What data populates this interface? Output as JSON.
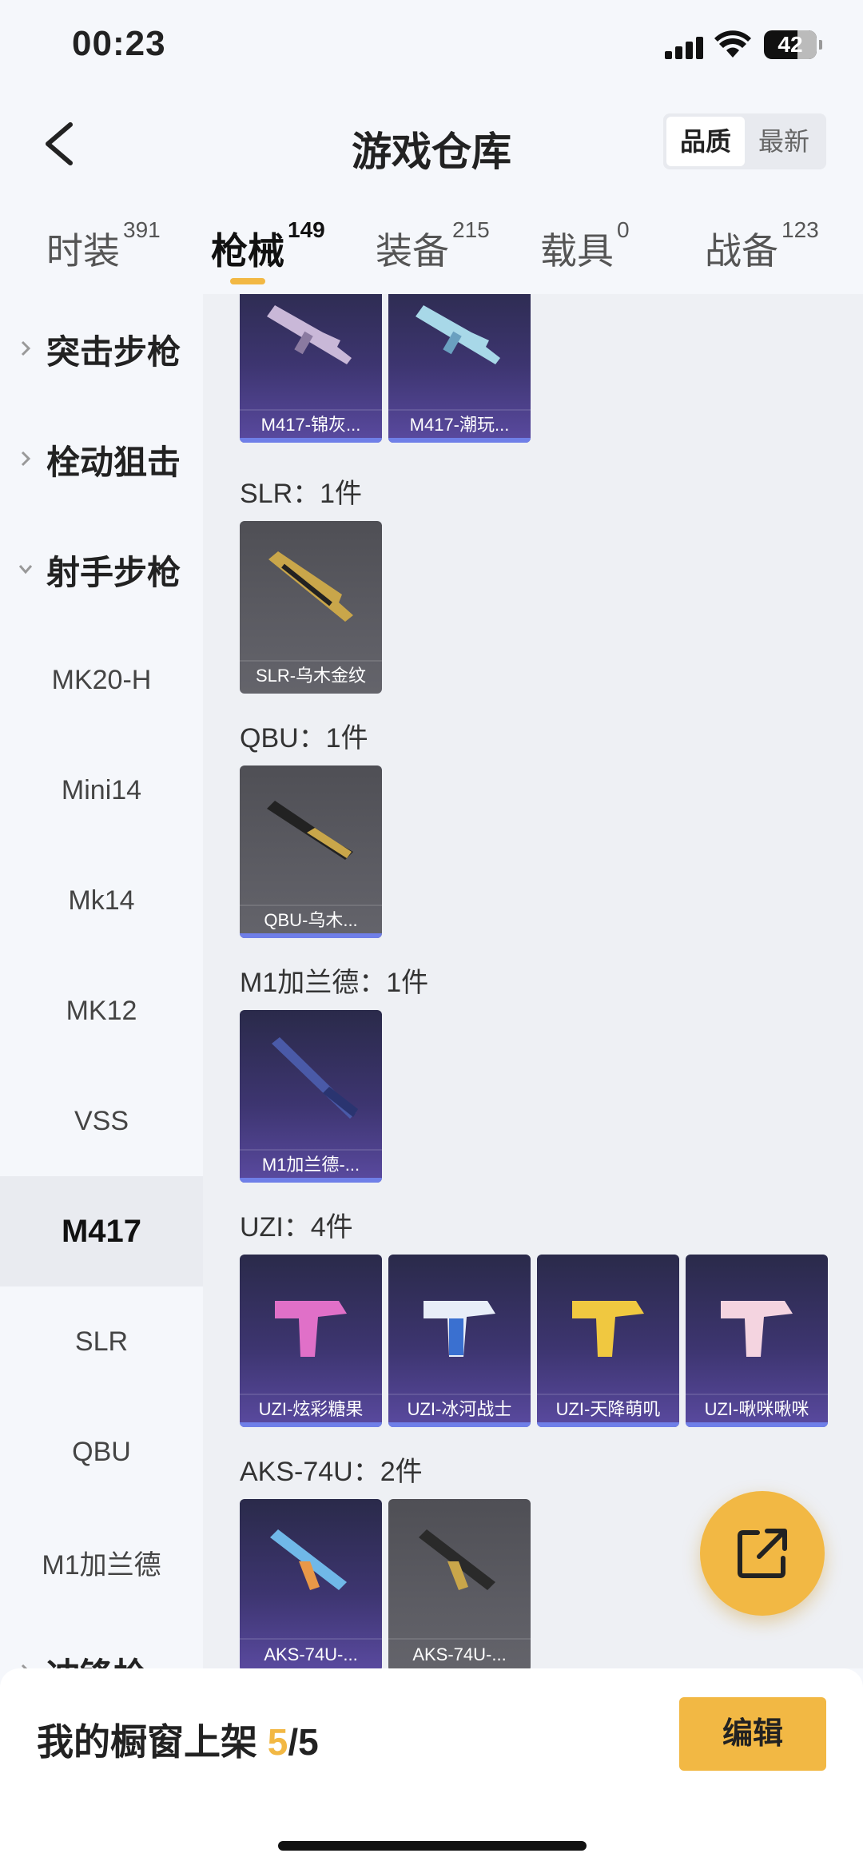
{
  "status": {
    "time": "00:23",
    "battery": "42"
  },
  "header": {
    "title": "游戏仓库",
    "back_icon": "chevron-left-icon",
    "sort": {
      "quality": "品质",
      "newest": "最新"
    }
  },
  "tabs": [
    {
      "label": "时装",
      "count": "391"
    },
    {
      "label": "枪械",
      "count": "149"
    },
    {
      "label": "装备",
      "count": "215"
    },
    {
      "label": "载具",
      "count": "0"
    },
    {
      "label": "战备",
      "count": "123"
    }
  ],
  "sidebar": {
    "items": [
      {
        "label": "突击步枪"
      },
      {
        "label": "栓动狙击"
      },
      {
        "label": "射手步枪"
      },
      {
        "label": "MK20-H"
      },
      {
        "label": "Mini14"
      },
      {
        "label": "Mk14"
      },
      {
        "label": "MK12"
      },
      {
        "label": "VSS"
      },
      {
        "label": "M417"
      },
      {
        "label": "SLR"
      },
      {
        "label": "QBU"
      },
      {
        "label": "M1加兰德"
      },
      {
        "label": "冲锋枪"
      }
    ]
  },
  "groups": {
    "m417": {
      "items": [
        {
          "name": "M417-锦灰..."
        },
        {
          "name": "M417-潮玩..."
        }
      ]
    },
    "slr": {
      "label": "SLR：1件",
      "items": [
        {
          "name": "SLR-乌木金纹"
        }
      ]
    },
    "qbu": {
      "label": "QBU：1件",
      "items": [
        {
          "name": "QBU-乌木..."
        }
      ]
    },
    "m1": {
      "label": "M1加兰德：1件",
      "items": [
        {
          "name": "M1加兰德-..."
        }
      ]
    },
    "uzi": {
      "label": "UZI：4件",
      "items": [
        {
          "name": "UZI-炫彩糖果"
        },
        {
          "name": "UZI-冰河战士"
        },
        {
          "name": "UZI-天降萌叽"
        },
        {
          "name": "UZI-啾咪啾咪"
        }
      ]
    },
    "aks": {
      "label": "AKS-74U：2件",
      "items": [
        {
          "name": "AKS-74U-..."
        },
        {
          "name": "AKS-74U-..."
        }
      ]
    }
  },
  "fab": {
    "icon": "share-external-icon"
  },
  "bottom": {
    "label_prefix": "我的橱窗上架 ",
    "count": "5",
    "total": "/5",
    "edit": "编辑"
  },
  "colors": {
    "accent": "#f2b844",
    "card_purple": "#3d3570",
    "card_grey": "#5c5c63"
  }
}
